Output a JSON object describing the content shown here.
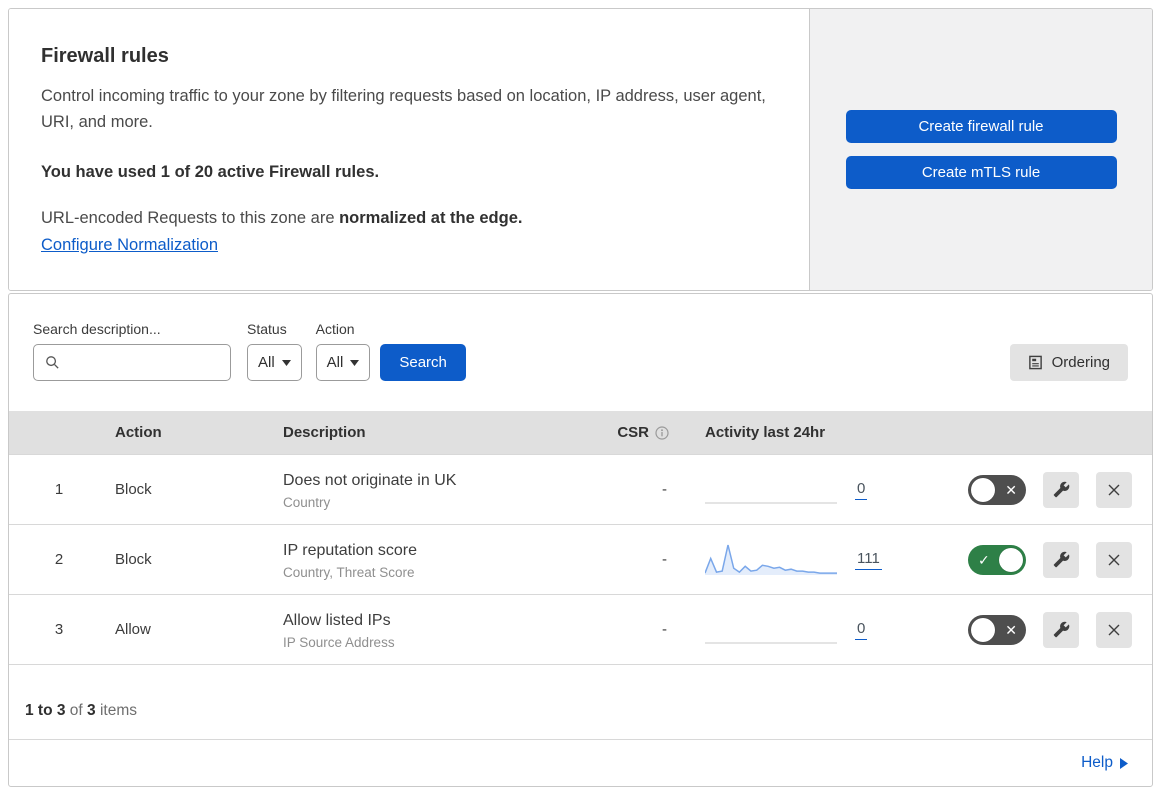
{
  "header": {
    "title": "Firewall rules",
    "description": "Control incoming traffic to your zone by filtering requests based on location, IP address, user agent, URI, and more.",
    "usage": "You have used 1 of 20 active Firewall rules.",
    "normalization_text": "URL-encoded Requests to this zone are ",
    "normalization_bold": "normalized at the edge.",
    "configure_link": "Configure Normalization"
  },
  "actions_panel": {
    "create_firewall_label": "Create firewall rule",
    "create_mtls_label": "Create mTLS rule"
  },
  "filters": {
    "search_label": "Search description...",
    "search_value": "",
    "status_label": "Status",
    "status_value": "All",
    "action_label": "Action",
    "action_value": "All",
    "search_button": "Search",
    "ordering_button": "Ordering"
  },
  "table": {
    "columns": {
      "action": "Action",
      "description": "Description",
      "csr": "CSR",
      "activity": "Activity last 24hr"
    },
    "rows": [
      {
        "num": "1",
        "action": "Block",
        "description": "Does not originate in UK",
        "fields": "Country",
        "csr": "-",
        "activity_count": "0",
        "enabled": false,
        "sparkline": [
          0,
          0,
          0,
          0,
          0,
          0,
          0,
          0,
          0,
          0,
          0,
          0,
          0,
          0,
          0,
          0,
          0,
          0,
          0,
          0,
          0,
          0,
          0,
          0
        ]
      },
      {
        "num": "2",
        "action": "Block",
        "description": "IP reputation score",
        "fields": "Country, Threat Score",
        "csr": "-",
        "activity_count": "111",
        "enabled": true,
        "sparkline": [
          2,
          17,
          3,
          4,
          31,
          7,
          3,
          9,
          4,
          5,
          10,
          9,
          7,
          8,
          5,
          6,
          4,
          4,
          3,
          3,
          2,
          2,
          2,
          2
        ]
      },
      {
        "num": "3",
        "action": "Allow",
        "description": "Allow listed IPs",
        "fields": "IP Source Address",
        "csr": "-",
        "activity_count": "0",
        "enabled": false,
        "sparkline": [
          0,
          0,
          0,
          0,
          0,
          0,
          0,
          0,
          0,
          0,
          0,
          0,
          0,
          0,
          0,
          0,
          0,
          0,
          0,
          0,
          0,
          0,
          0,
          0
        ]
      }
    ]
  },
  "footer": {
    "range": "1 to 3",
    "of": "of",
    "total": "3",
    "items": "items"
  },
  "help": {
    "label": "Help"
  },
  "colors": {
    "accent_blue": "#0d5cc9",
    "toggle_on_green": "#2e8047",
    "toggle_off_gray": "#4e4e4e",
    "sparkline_blue": "#7aa7ea",
    "sparkline_fill": "rgba(122,167,234,0.20)",
    "flat_line": "#c9c9c9",
    "table_header_bg": "#e0e0e0",
    "panel_gray": "#f1f1f2"
  }
}
